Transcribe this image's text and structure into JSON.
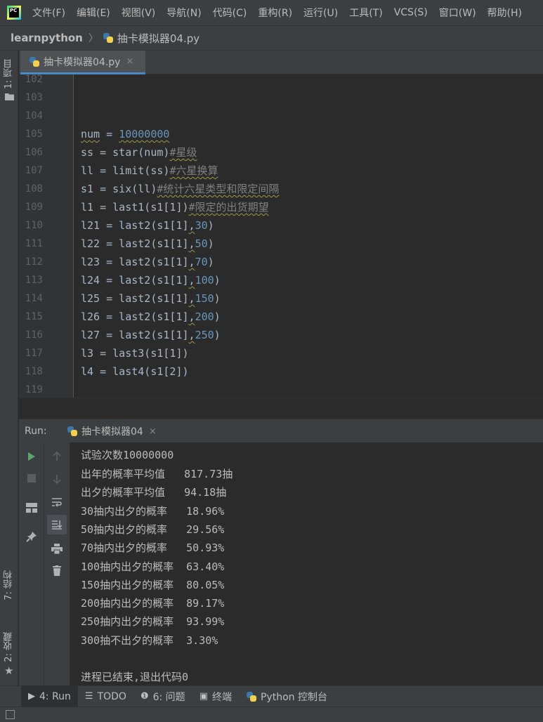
{
  "menu": [
    "文件(F)",
    "编辑(E)",
    "视图(V)",
    "导航(N)",
    "代码(C)",
    "重构(R)",
    "运行(U)",
    "工具(T)",
    "VCS(S)",
    "窗口(W)",
    "帮助(H)"
  ],
  "app_logo_text": "PC",
  "breadcrumb": {
    "project": "learnpython",
    "separator": "〉",
    "file": "抽卡模拟器04.py"
  },
  "left_strip": {
    "project_tab": "1: 项目",
    "structure_tab": "7: 结构",
    "favorites_tab": "2: 收藏"
  },
  "editor_tab": {
    "label": "抽卡模拟器04.py",
    "close": "×"
  },
  "code_lines": [
    {
      "n": "102"
    },
    {
      "n": "103"
    },
    {
      "n": "104"
    },
    {
      "n": "105"
    },
    {
      "n": "106"
    },
    {
      "n": "107"
    },
    {
      "n": "108"
    },
    {
      "n": "109"
    },
    {
      "n": "110"
    },
    {
      "n": "111"
    },
    {
      "n": "112"
    },
    {
      "n": "113"
    },
    {
      "n": "114"
    },
    {
      "n": "115"
    },
    {
      "n": "116"
    },
    {
      "n": "117"
    },
    {
      "n": "118"
    },
    {
      "n": "119"
    }
  ],
  "code": {
    "l105_var": "num",
    "l105_op": " = ",
    "l105_num": "10000000",
    "l106_code": "ss = star(num)",
    "l106_cmt": "#星级",
    "l107_code": "ll = limit(ss)",
    "l107_cmt": "#六星换算",
    "l108_code": "s1 = six(ll)",
    "l108_cmt": "#统计六星类型和限定间隔",
    "l109_code": "l1 = last1(s1[1])",
    "l109_cmt": "#限定的出货期望",
    "calls": [
      {
        "pre": "l21 = last2(s1[1]",
        "arg": "30"
      },
      {
        "pre": "l22 = last2(s1[1]",
        "arg": "50"
      },
      {
        "pre": "l23 = last2(s1[1]",
        "arg": "70"
      },
      {
        "pre": "l24 = last2(s1[1]",
        "arg": "100"
      },
      {
        "pre": "l25 = last2(s1[1]",
        "arg": "150"
      },
      {
        "pre": "l26 = last2(s1[1]",
        "arg": "200"
      },
      {
        "pre": "l27 = last2(s1[1]",
        "arg": "250"
      }
    ],
    "comma": ",",
    "close": ")",
    "l117_code": "l3 = last3(s1[1])",
    "l118_code": "l4 = last4(s1[2])"
  },
  "run_panel": {
    "label": "Run:",
    "tab": "抽卡模拟器04",
    "close": "×"
  },
  "console_lines": [
    "试验次数10000000",
    "出年的概率平均值   817.73抽",
    "出夕的概率平均值   94.18抽",
    "30抽内出夕的概率   18.96%",
    "50抽内出夕的概率   29.56%",
    "70抽内出夕的概率   50.93%",
    "100抽内出夕的概率  63.40%",
    "150抽内出夕的概率  80.05%",
    "200抽内出夕的概率  89.17%",
    "250抽内出夕的概率  93.99%",
    "300抽不出夕的概率  3.30%",
    "",
    "进程已结束,退出代码0"
  ],
  "bottom_tabs": {
    "run": "4: Run",
    "todo": "TODO",
    "problems": "6: 问题",
    "terminal": "终端",
    "python_console": "Python 控制台"
  },
  "colors": {
    "accent": "#4a88c7",
    "number": "#6897bb",
    "comment": "#808080",
    "run_green": "#59a869"
  }
}
